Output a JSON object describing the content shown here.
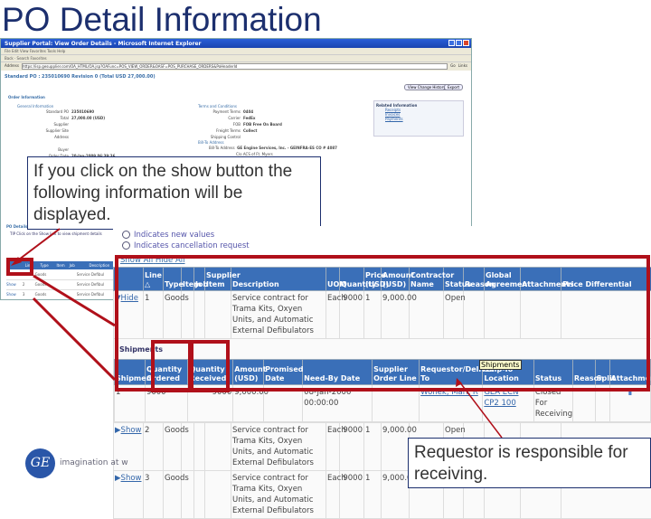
{
  "slide_title": "PO Detail Information",
  "browser": {
    "window_title": "Supplier Portal: View Order Details - Microsoft Internet Explorer",
    "menu": "File  Edit  View  Favorites  Tools  Help",
    "toolbar": "Back  ·  Search  Favorites",
    "address_label": "Address",
    "url": "https://isp.gesupplier.com/OA_HTML/OA.jsp?OAFunc=POS_VIEW_ORDER&OASF=POS_PURCHASE_ORDERS&PoHeaderId",
    "go": "Go",
    "links": "Links",
    "po_header": "Standard PO : 235010690 Revision 0 (Total USD 27,000.00)",
    "view_change_history": "View Change History",
    "export": "Export",
    "order_information": "Order Information",
    "general_information": "General Information",
    "general": [
      [
        "Standard PO",
        "235010690"
      ],
      [
        "Total",
        "27,000.00 (USD)"
      ],
      [
        "Supplier",
        ""
      ],
      [
        "Supplier Site",
        ""
      ],
      [
        "Address",
        ""
      ],
      [
        "",
        ""
      ],
      [
        "Buyer",
        ""
      ],
      [
        "Order Date",
        "20-Jan-2009 06:39:36"
      ]
    ],
    "terms_and_conditions": "Terms and Conditions",
    "terms": [
      [
        "Payment Terms",
        "0404"
      ],
      [
        "Carrier",
        "FedEx"
      ],
      [
        "FOB",
        "FOB Free On Board"
      ],
      [
        "Freight Terms",
        "Collect"
      ],
      [
        "Shipping Control",
        ""
      ]
    ],
    "bill_to_address": "Bill-To Address",
    "bill_to": [
      "Bill-To Address",
      "GE Engine Services, Inc. - GEINFRA-ES CO # 4087",
      "C/o ACS of Ft. Myers"
    ],
    "related_information": "Related Information",
    "related_links": [
      "Receipts",
      "Invoices",
      "Payments"
    ],
    "po_details": "PO Details",
    "tip": "TIP  Click on the Show link to view shipment details",
    "small_rows": [
      [
        "Show",
        "1",
        "Goods",
        "Service Defibul"
      ],
      [
        "Show",
        "2",
        "Goods",
        "Service Defibul"
      ],
      [
        "Show",
        "3",
        "Goods",
        "Service Defibul"
      ]
    ]
  },
  "callout_show": "If you click on the show button the following information will be displayed.",
  "callout_requestor": "Requestor is responsible for receiving.",
  "legend": {
    "new_values": "Indicates new values",
    "cancellation": "Indicates cancellation request"
  },
  "show_all": "Show All",
  "hide_all": "Hide All",
  "lines_table": {
    "headers": [
      "",
      "Line △",
      "Type",
      "Item",
      "Job",
      "Supplier Item",
      "Description",
      "UOM",
      "Quantity",
      "Price (USD)",
      "Amount (USD)",
      "Contractor Name",
      "Status",
      "Reason",
      "Global Agreement",
      "Attachments",
      "Price Differential"
    ],
    "rows": [
      {
        "toggle": "Hide",
        "line": "1",
        "type": "Goods",
        "description": "Service contract for Trama Kits, Oxyen Units, and Automatic External Defibulators",
        "uom": "Each",
        "quantity": "9000",
        "price": "1",
        "amount": "9,000.00",
        "status": "Open"
      },
      {
        "toggle": "Show",
        "line": "2",
        "type": "Goods",
        "description": "Service contract for Trama Kits, Oxyen Units, and Automatic External Defibulators",
        "uom": "Each",
        "quantity": "9000",
        "price": "1",
        "amount": "9,000.00",
        "status": "Open"
      },
      {
        "toggle": "Show",
        "line": "3",
        "type": "Goods",
        "description": "Service contract for Trama Kits, Oxyen Units, and Automatic External Defibulators",
        "uom": "Each",
        "quantity": "9000",
        "price": "1",
        "amount": "9,000.00",
        "status": "Open"
      }
    ]
  },
  "shipments": {
    "label": "Shipments",
    "headers": [
      "Shipment",
      "Quantity Ordered",
      "Quantity Received",
      "Amount (USD)",
      "Promised Date",
      "Need-By Date",
      "Supplier Order Line",
      "Requestor/Deliver To",
      "Ship-To Location",
      "Status",
      "Reason",
      "Split",
      "Attachments"
    ],
    "row": {
      "shipment": "1",
      "qty_ordered": "9000",
      "qty_received": "9000",
      "amount": "9,000.00",
      "need_by": "08-Jan-2006 00:00:00",
      "requestor": "Wonek, Mark R",
      "ship_to": "GEA ECN CP2 100",
      "status": "Closed For Receiving"
    },
    "tooltip": "Shipments"
  },
  "footer": {
    "tagline": "imagination at w"
  },
  "colors": {
    "title": "#1c2f6e",
    "header_blue": "#3a6fb8",
    "highlight_red": "#b0101a"
  }
}
